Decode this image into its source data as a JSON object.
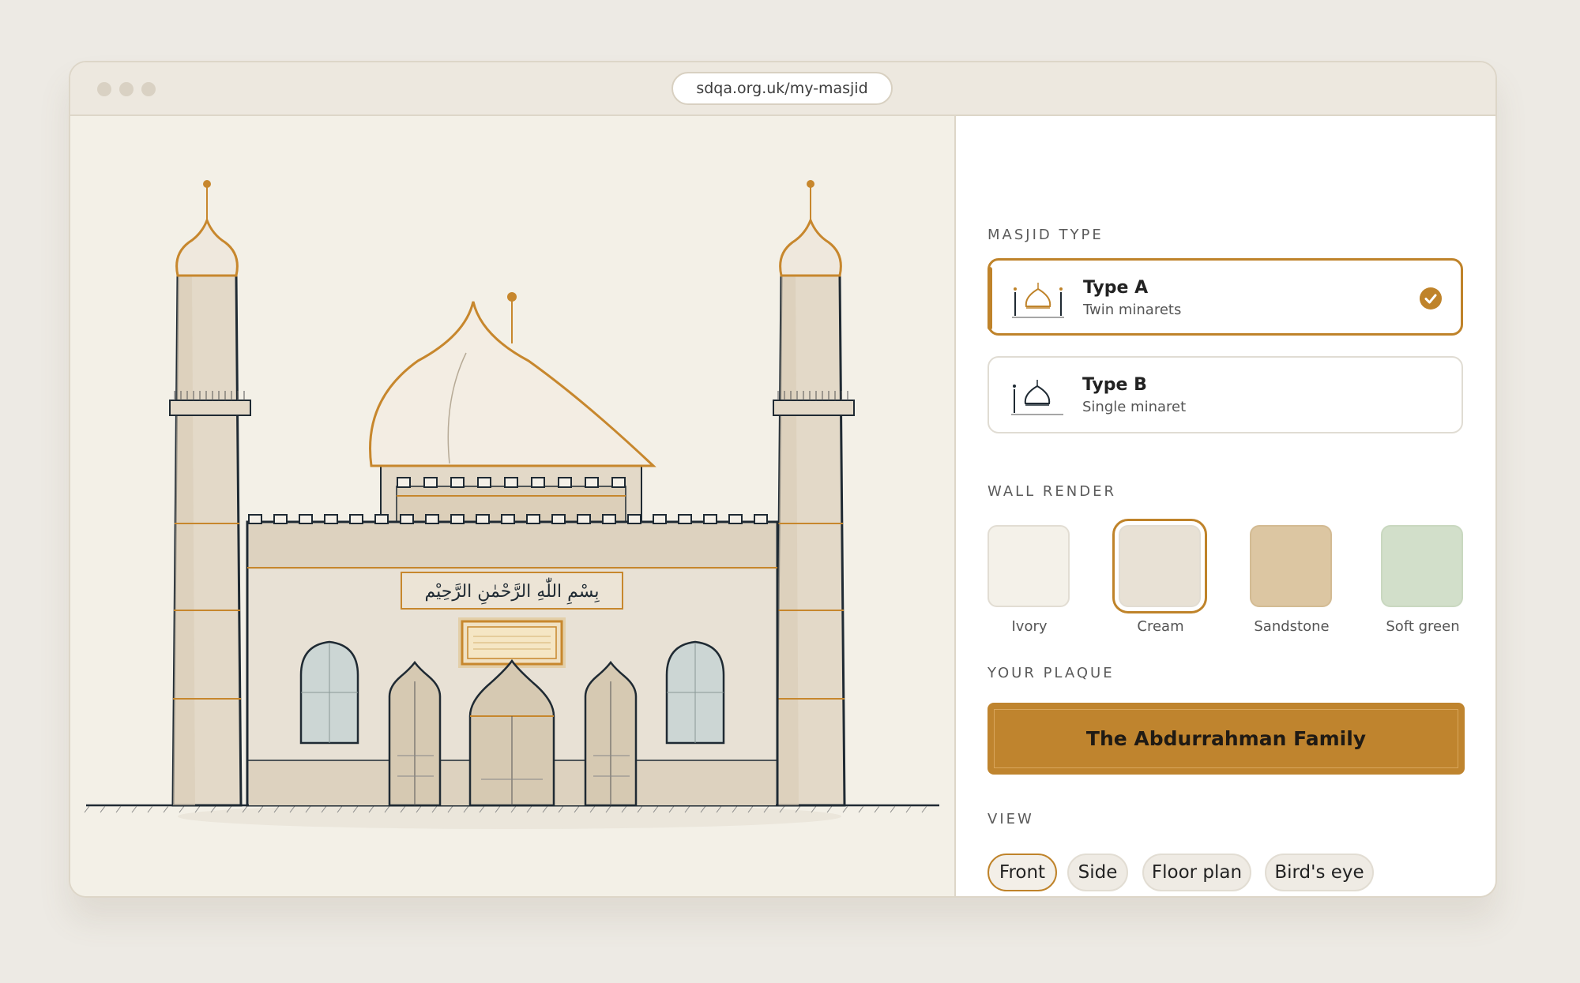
{
  "browser": {
    "url": "sdqa.org.uk/my-masjid"
  },
  "illustration": {
    "arabic_text": "بِسْمِ اللّٰهِ الرَّحْمٰنِ الرَّحِيْم"
  },
  "panel": {
    "masjid_type": {
      "title": "MASJID TYPE",
      "options": [
        {
          "label": "Type A",
          "description": "Twin minarets",
          "selected": true,
          "icon": "twin-minaret-icon"
        },
        {
          "label": "Type B",
          "description": "Single minaret",
          "selected": false,
          "icon": "single-minaret-icon"
        }
      ]
    },
    "wall_render": {
      "title": "WALL RENDER",
      "options": [
        {
          "label": "Ivory",
          "color": "#f4f1e9",
          "selected": false
        },
        {
          "label": "Cream",
          "color": "#e8e1d5",
          "selected": true
        },
        {
          "label": "Sandstone",
          "color": "#dcc6a2",
          "selected": false
        },
        {
          "label": "Soft green",
          "color": "#d2dfca",
          "selected": false
        }
      ]
    },
    "plaque": {
      "title": "YOUR PLAQUE",
      "text": "The Abdurrahman Family"
    },
    "view": {
      "title": "VIEW",
      "options": [
        {
          "label": "Front",
          "selected": true
        },
        {
          "label": "Side",
          "selected": false
        },
        {
          "label": "Floor plan",
          "selected": false
        },
        {
          "label": "Bird's eye",
          "selected": false
        }
      ]
    }
  },
  "colors": {
    "accent": "#bf832a",
    "wall": "#e8e1d5",
    "outline": "#1f2a33"
  }
}
